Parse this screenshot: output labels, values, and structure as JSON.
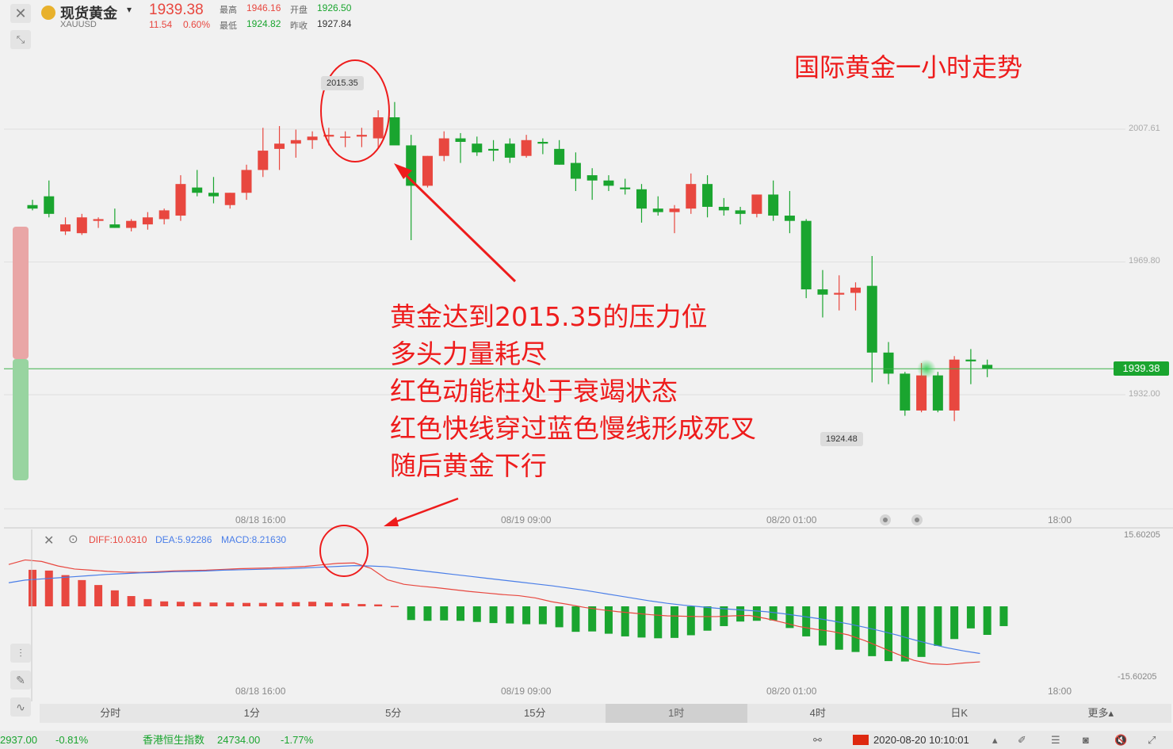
{
  "header": {
    "symbol_name": "现货黄金",
    "symbol_code": "XAUUSD",
    "price": "1939.38",
    "change": "11.54",
    "change_pct": "0.60%",
    "high_label": "最高",
    "high_value": "1946.16",
    "open_label": "开盘",
    "open_value": "1926.50",
    "low_label": "最低",
    "low_value": "1924.82",
    "prev_close_label": "昨收",
    "prev_close_value": "1927.84"
  },
  "main_chart": {
    "price_axis": [
      "2007.61",
      "1969.80",
      "1932.00"
    ],
    "current_price_tag": "1939.38",
    "high_marker": "2015.35",
    "low_marker": "1924.48",
    "time_axis": [
      "08/18 16:00",
      "08/19 09:00",
      "08/20 01:00",
      "18:00"
    ]
  },
  "macd": {
    "diff_label": "DIFF:10.0310",
    "dea_label": "DEA:5.92286",
    "macd_label": "MACD:8.21630",
    "axis_top": "15.60205",
    "axis_bottom": "-15.60205",
    "time_axis": [
      "08/18 16:00",
      "08/19 09:00",
      "08/20 01:00",
      "18:00"
    ]
  },
  "annotations": {
    "title": "国际黄金一小时走势",
    "lines": [
      "黄金达到2015.35的压力位",
      "多头力量耗尽",
      "红色动能柱处于衰竭状态",
      "红色快线穿过蓝色慢线形成死叉",
      "随后黄金下行"
    ]
  },
  "tabs": [
    "分时",
    "1分",
    "5分",
    "15分",
    "1时",
    "4时",
    "日K",
    "更多▴"
  ],
  "active_tab": "1时",
  "ticker": {
    "left_value": "2937.00",
    "left_change": "-0.81%",
    "index_name": "香港恒生指数",
    "index_value": "24734.00",
    "index_change": "-1.77%",
    "datetime": "2020-08-20 10:10:01"
  },
  "colors": {
    "up": "#e8473f",
    "down": "#1aa52f",
    "dif_line": "#e8473f",
    "dea_line": "#4a7ee8",
    "annotation": "#ee1c1c"
  },
  "chart_data": [
    {
      "type": "candlestick",
      "title": "",
      "description_label": "",
      "x_labels": [
        "08/18 16:00",
        "08/19 09:00",
        "08/20 01:00",
        "18:00"
      ],
      "ylim": [
        1910,
        2030
      ],
      "y_ticks": [
        2007.61,
        1969.8,
        1932.0
      ],
      "current": 1939.38,
      "high": 2015.35,
      "low": 1924.48,
      "candles": [
        {
          "o": 1986.0,
          "h": 1987.5,
          "l": 1984.5,
          "c": 1985.0
        },
        {
          "o": 1988.5,
          "h": 1993.0,
          "l": 1982.5,
          "c": 1983.5
        },
        {
          "o": 1978.5,
          "h": 1982.5,
          "l": 1977.5,
          "c": 1980.5
        },
        {
          "o": 1978.0,
          "h": 1983.5,
          "l": 1977.5,
          "c": 1982.5
        },
        {
          "o": 1981.5,
          "h": 1982.5,
          "l": 1979.5,
          "c": 1982.0
        },
        {
          "o": 1980.5,
          "h": 1985.0,
          "l": 1979.5,
          "c": 1979.5
        },
        {
          "o": 1979.5,
          "h": 1982.0,
          "l": 1978.5,
          "c": 1981.5
        },
        {
          "o": 1980.5,
          "h": 1984.0,
          "l": 1979.0,
          "c": 1982.5
        },
        {
          "o": 1982.0,
          "h": 1985.0,
          "l": 1980.5,
          "c": 1984.5
        },
        {
          "o": 1983.0,
          "h": 1994.5,
          "l": 1981.5,
          "c": 1992.0
        },
        {
          "o": 1991.0,
          "h": 1996.0,
          "l": 1988.5,
          "c": 1989.5
        },
        {
          "o": 1989.5,
          "h": 1994.0,
          "l": 1986.5,
          "c": 1988.5
        },
        {
          "o": 1986.0,
          "h": 1989.5,
          "l": 1985.0,
          "c": 1989.5
        },
        {
          "o": 1989.5,
          "h": 1997.5,
          "l": 1987.5,
          "c": 1996.0
        },
        {
          "o": 1996.0,
          "h": 2008.0,
          "l": 1994.0,
          "c": 2001.5
        },
        {
          "o": 2002.0,
          "h": 2008.5,
          "l": 1996.0,
          "c": 2003.5
        },
        {
          "o": 2003.5,
          "h": 2007.5,
          "l": 1999.5,
          "c": 2004.5
        },
        {
          "o": 2004.5,
          "h": 2007.0,
          "l": 2002.0,
          "c": 2005.5
        },
        {
          "o": 2005.5,
          "h": 2008.0,
          "l": 2003.0,
          "c": 2006.0
        },
        {
          "o": 2005.5,
          "h": 2007.0,
          "l": 2002.5,
          "c": 2005.5
        },
        {
          "o": 2005.5,
          "h": 2008.0,
          "l": 2002.5,
          "c": 2006.0
        },
        {
          "o": 2005.0,
          "h": 2013.0,
          "l": 2002.0,
          "c": 2011.0
        },
        {
          "o": 2011.0,
          "h": 2015.35,
          "l": 2004.0,
          "c": 2003.0
        },
        {
          "o": 2003.0,
          "h": 2006.0,
          "l": 1976.0,
          "c": 1991.5
        },
        {
          "o": 1991.5,
          "h": 2000.0,
          "l": 1991.0,
          "c": 2000.0
        },
        {
          "o": 2000.0,
          "h": 2007.0,
          "l": 1998.5,
          "c": 2005.0
        },
        {
          "o": 2005.0,
          "h": 2006.5,
          "l": 1998.0,
          "c": 2004.0
        },
        {
          "o": 2003.5,
          "h": 2005.5,
          "l": 2000.0,
          "c": 2001.0
        },
        {
          "o": 2002.0,
          "h": 2004.5,
          "l": 1998.5,
          "c": 2001.5
        },
        {
          "o": 2003.5,
          "h": 2005.0,
          "l": 1998.0,
          "c": 1999.5
        },
        {
          "o": 2000.0,
          "h": 2006.0,
          "l": 1999.5,
          "c": 2004.5
        },
        {
          "o": 2004.0,
          "h": 2005.0,
          "l": 2000.5,
          "c": 2003.5
        },
        {
          "o": 2002.0,
          "h": 2004.5,
          "l": 1997.5,
          "c": 1997.5
        },
        {
          "o": 1998.0,
          "h": 2001.0,
          "l": 1990.0,
          "c": 1993.5
        },
        {
          "o": 1994.5,
          "h": 1996.5,
          "l": 1987.5,
          "c": 1993.0
        },
        {
          "o": 1993.0,
          "h": 1994.5,
          "l": 1990.0,
          "c": 1991.5
        },
        {
          "o": 1991.0,
          "h": 1993.5,
          "l": 1989.0,
          "c": 1990.5
        },
        {
          "o": 1990.5,
          "h": 1992.0,
          "l": 1981.0,
          "c": 1985.0
        },
        {
          "o": 1985.0,
          "h": 1988.5,
          "l": 1983.0,
          "c": 1984.0
        },
        {
          "o": 1984.0,
          "h": 1986.0,
          "l": 1978.0,
          "c": 1985.0
        },
        {
          "o": 1985.0,
          "h": 1995.0,
          "l": 1983.5,
          "c": 1992.0
        },
        {
          "o": 1992.0,
          "h": 1994.5,
          "l": 1982.5,
          "c": 1985.5
        },
        {
          "o": 1985.5,
          "h": 1988.0,
          "l": 1983.0,
          "c": 1984.5
        },
        {
          "o": 1984.5,
          "h": 1985.5,
          "l": 1980.5,
          "c": 1983.5
        },
        {
          "o": 1983.5,
          "h": 1989.0,
          "l": 1982.5,
          "c": 1989.0
        },
        {
          "o": 1989.0,
          "h": 1993.0,
          "l": 1981.5,
          "c": 1983.0
        },
        {
          "o": 1983.0,
          "h": 1990.0,
          "l": 1978.0,
          "c": 1981.5
        },
        {
          "o": 1981.5,
          "h": 1982.0,
          "l": 1959.5,
          "c": 1962.0
        },
        {
          "o": 1962.0,
          "h": 1967.5,
          "l": 1954.0,
          "c": 1960.5
        },
        {
          "o": 1960.5,
          "h": 1966.0,
          "l": 1956.0,
          "c": 1961.0
        },
        {
          "o": 1961.0,
          "h": 1964.0,
          "l": 1956.0,
          "c": 1962.5
        },
        {
          "o": 1963.0,
          "h": 1971.5,
          "l": 1935.5,
          "c": 1944.0
        },
        {
          "o": 1944.0,
          "h": 1947.0,
          "l": 1935.0,
          "c": 1938.0
        },
        {
          "o": 1938.0,
          "h": 1938.5,
          "l": 1926.0,
          "c": 1927.5
        },
        {
          "o": 1927.5,
          "h": 1941.0,
          "l": 1927.0,
          "c": 1937.5
        },
        {
          "o": 1937.5,
          "h": 1938.5,
          "l": 1927.0,
          "c": 1927.5
        },
        {
          "o": 1927.5,
          "h": 1943.0,
          "l": 1924.48,
          "c": 1942.0
        },
        {
          "o": 1942.0,
          "h": 1945.0,
          "l": 1935.0,
          "c": 1941.5
        },
        {
          "o": 1940.5,
          "h": 1942.0,
          "l": 1937.0,
          "c": 1939.38
        }
      ]
    },
    {
      "type": "bar",
      "title": "",
      "ylim": [
        -15.60205,
        15.60205
      ],
      "series": [
        {
          "name": "MACD",
          "values": [
            9.6,
            9.4,
            8.2,
            6.9,
            5.6,
            4.2,
            2.7,
            1.9,
            1.3,
            1.2,
            1.1,
            1.0,
            1.0,
            0.9,
            0.9,
            1.0,
            1.1,
            1.2,
            1.0,
            0.8,
            0.6,
            0.5,
            0.1,
            -3.6,
            -3.8,
            -3.7,
            -3.8,
            -4.1,
            -4.4,
            -4.5,
            -4.7,
            -4.7,
            -5.5,
            -6.7,
            -6.6,
            -7.2,
            -7.9,
            -8.2,
            -8.4,
            -8.3,
            -7.6,
            -6.4,
            -5.2,
            -4.0,
            -3.8,
            -3.7,
            -5.7,
            -7.9,
            -10.3,
            -11.4,
            -12.0,
            -13.1,
            -14.4,
            -14.5,
            -13.3,
            -10.4,
            -8.6,
            -5.8,
            -7.5,
            -5.2
          ]
        },
        {
          "name": "DIFF",
          "values": [
            11.0,
            12.2,
            11.8,
            10.6,
            9.8,
            9.5,
            9.2,
            9.0,
            8.9,
            9.1,
            9.3,
            9.4,
            9.5,
            9.7,
            9.9,
            10.0,
            10.1,
            10.3,
            10.5,
            10.9,
            11.3,
            11.4,
            10.0,
            7.0,
            5.8,
            5.3,
            4.9,
            4.4,
            3.9,
            3.5,
            3.1,
            2.8,
            2.2,
            1.2,
            0.5,
            -0.3,
            -0.9,
            -1.4,
            -1.8,
            -2.2,
            -2.5,
            -2.6,
            -2.7,
            -2.7,
            -2.5,
            -2.4,
            -3.2,
            -4.2,
            -5.3,
            -6.0,
            -6.6,
            -7.5,
            -9.0,
            -10.8,
            -12.6,
            -14.2,
            -15.1,
            -15.3,
            -14.9,
            -14.6
          ]
        },
        {
          "name": "DEA",
          "values": [
            6.2,
            6.9,
            7.2,
            7.5,
            7.8,
            8.1,
            8.4,
            8.6,
            8.8,
            8.9,
            9.1,
            9.2,
            9.3,
            9.5,
            9.6,
            9.7,
            9.8,
            9.9,
            10.1,
            10.3,
            10.5,
            10.7,
            10.6,
            10.4,
            9.9,
            9.4,
            8.9,
            8.4,
            7.9,
            7.4,
            6.9,
            6.4,
            5.9,
            5.4,
            4.8,
            4.2,
            3.5,
            2.8,
            2.1,
            1.4,
            0.8,
            0.3,
            -0.1,
            -0.5,
            -0.8,
            -1.1,
            -1.4,
            -1.9,
            -2.5,
            -3.1,
            -3.8,
            -4.6,
            -5.5,
            -6.5,
            -7.6,
            -8.8,
            -9.9,
            -10.9,
            -11.7,
            -12.4
          ]
        }
      ]
    }
  ]
}
